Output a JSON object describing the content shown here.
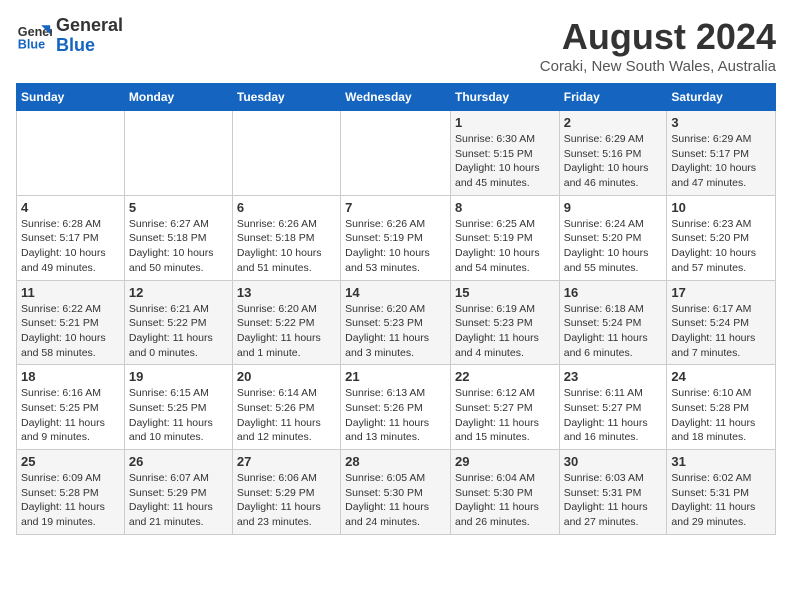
{
  "logo": {
    "line1": "General",
    "line2": "Blue"
  },
  "title": {
    "month_year": "August 2024",
    "location": "Coraki, New South Wales, Australia"
  },
  "weekdays": [
    "Sunday",
    "Monday",
    "Tuesday",
    "Wednesday",
    "Thursday",
    "Friday",
    "Saturday"
  ],
  "weeks": [
    [
      {
        "day": "",
        "info": ""
      },
      {
        "day": "",
        "info": ""
      },
      {
        "day": "",
        "info": ""
      },
      {
        "day": "",
        "info": ""
      },
      {
        "day": "1",
        "info": "Sunrise: 6:30 AM\nSunset: 5:15 PM\nDaylight: 10 hours and 45 minutes."
      },
      {
        "day": "2",
        "info": "Sunrise: 6:29 AM\nSunset: 5:16 PM\nDaylight: 10 hours and 46 minutes."
      },
      {
        "day": "3",
        "info": "Sunrise: 6:29 AM\nSunset: 5:17 PM\nDaylight: 10 hours and 47 minutes."
      }
    ],
    [
      {
        "day": "4",
        "info": "Sunrise: 6:28 AM\nSunset: 5:17 PM\nDaylight: 10 hours and 49 minutes."
      },
      {
        "day": "5",
        "info": "Sunrise: 6:27 AM\nSunset: 5:18 PM\nDaylight: 10 hours and 50 minutes."
      },
      {
        "day": "6",
        "info": "Sunrise: 6:26 AM\nSunset: 5:18 PM\nDaylight: 10 hours and 51 minutes."
      },
      {
        "day": "7",
        "info": "Sunrise: 6:26 AM\nSunset: 5:19 PM\nDaylight: 10 hours and 53 minutes."
      },
      {
        "day": "8",
        "info": "Sunrise: 6:25 AM\nSunset: 5:19 PM\nDaylight: 10 hours and 54 minutes."
      },
      {
        "day": "9",
        "info": "Sunrise: 6:24 AM\nSunset: 5:20 PM\nDaylight: 10 hours and 55 minutes."
      },
      {
        "day": "10",
        "info": "Sunrise: 6:23 AM\nSunset: 5:20 PM\nDaylight: 10 hours and 57 minutes."
      }
    ],
    [
      {
        "day": "11",
        "info": "Sunrise: 6:22 AM\nSunset: 5:21 PM\nDaylight: 10 hours and 58 minutes."
      },
      {
        "day": "12",
        "info": "Sunrise: 6:21 AM\nSunset: 5:22 PM\nDaylight: 11 hours and 0 minutes."
      },
      {
        "day": "13",
        "info": "Sunrise: 6:20 AM\nSunset: 5:22 PM\nDaylight: 11 hours and 1 minute."
      },
      {
        "day": "14",
        "info": "Sunrise: 6:20 AM\nSunset: 5:23 PM\nDaylight: 11 hours and 3 minutes."
      },
      {
        "day": "15",
        "info": "Sunrise: 6:19 AM\nSunset: 5:23 PM\nDaylight: 11 hours and 4 minutes."
      },
      {
        "day": "16",
        "info": "Sunrise: 6:18 AM\nSunset: 5:24 PM\nDaylight: 11 hours and 6 minutes."
      },
      {
        "day": "17",
        "info": "Sunrise: 6:17 AM\nSunset: 5:24 PM\nDaylight: 11 hours and 7 minutes."
      }
    ],
    [
      {
        "day": "18",
        "info": "Sunrise: 6:16 AM\nSunset: 5:25 PM\nDaylight: 11 hours and 9 minutes."
      },
      {
        "day": "19",
        "info": "Sunrise: 6:15 AM\nSunset: 5:25 PM\nDaylight: 11 hours and 10 minutes."
      },
      {
        "day": "20",
        "info": "Sunrise: 6:14 AM\nSunset: 5:26 PM\nDaylight: 11 hours and 12 minutes."
      },
      {
        "day": "21",
        "info": "Sunrise: 6:13 AM\nSunset: 5:26 PM\nDaylight: 11 hours and 13 minutes."
      },
      {
        "day": "22",
        "info": "Sunrise: 6:12 AM\nSunset: 5:27 PM\nDaylight: 11 hours and 15 minutes."
      },
      {
        "day": "23",
        "info": "Sunrise: 6:11 AM\nSunset: 5:27 PM\nDaylight: 11 hours and 16 minutes."
      },
      {
        "day": "24",
        "info": "Sunrise: 6:10 AM\nSunset: 5:28 PM\nDaylight: 11 hours and 18 minutes."
      }
    ],
    [
      {
        "day": "25",
        "info": "Sunrise: 6:09 AM\nSunset: 5:28 PM\nDaylight: 11 hours and 19 minutes."
      },
      {
        "day": "26",
        "info": "Sunrise: 6:07 AM\nSunset: 5:29 PM\nDaylight: 11 hours and 21 minutes."
      },
      {
        "day": "27",
        "info": "Sunrise: 6:06 AM\nSunset: 5:29 PM\nDaylight: 11 hours and 23 minutes."
      },
      {
        "day": "28",
        "info": "Sunrise: 6:05 AM\nSunset: 5:30 PM\nDaylight: 11 hours and 24 minutes."
      },
      {
        "day": "29",
        "info": "Sunrise: 6:04 AM\nSunset: 5:30 PM\nDaylight: 11 hours and 26 minutes."
      },
      {
        "day": "30",
        "info": "Sunrise: 6:03 AM\nSunset: 5:31 PM\nDaylight: 11 hours and 27 minutes."
      },
      {
        "day": "31",
        "info": "Sunrise: 6:02 AM\nSunset: 5:31 PM\nDaylight: 11 hours and 29 minutes."
      }
    ]
  ]
}
